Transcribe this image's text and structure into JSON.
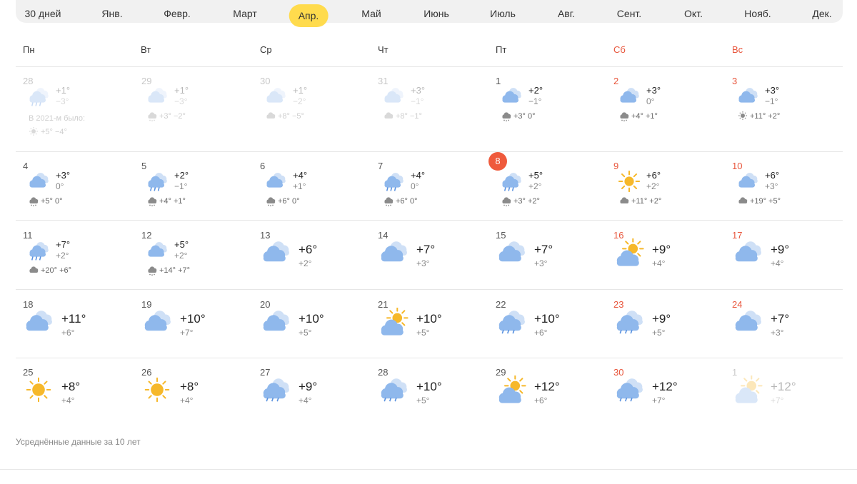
{
  "months": [
    "30 дней",
    "Янв.",
    "Февр.",
    "Март",
    "Апр.",
    "Май",
    "Июнь",
    "Июль",
    "Авг.",
    "Сент.",
    "Окт.",
    "Нояб.",
    "Дек."
  ],
  "active_month": 4,
  "weekdays": [
    "Пн",
    "Вт",
    "Ср",
    "Чт",
    "Пт",
    "Сб",
    "Вс"
  ],
  "footer_note": "Усреднённые данные за 10 лет",
  "history_2021_note": "В 2021-м было:",
  "weeks": [
    [
      {
        "d": "28",
        "faded": true,
        "icon": "cloud-rain",
        "hi": "+1°",
        "lo": "−3°",
        "h_icon": "sun",
        "h": "+5° −4°",
        "note": true
      },
      {
        "d": "29",
        "faded": true,
        "icon": "cloud",
        "hi": "+1°",
        "lo": "−3°",
        "h_icon": "sun-rain",
        "h": "+3° −2°"
      },
      {
        "d": "30",
        "faded": true,
        "icon": "cloud",
        "hi": "+1°",
        "lo": "−2°",
        "h_icon": "cloud-sun",
        "h": "+8° −5°"
      },
      {
        "d": "31",
        "faded": true,
        "icon": "cloud",
        "hi": "+3°",
        "lo": "−1°",
        "h_icon": "cloud-sun",
        "h": "+8° −1°"
      },
      {
        "d": "1",
        "icon": "cloud",
        "hi": "+2°",
        "lo": "−1°",
        "h_icon": "cloud-snow",
        "h": "+3° 0°"
      },
      {
        "d": "2",
        "icon": "cloud",
        "hi": "+3°",
        "lo": "0°",
        "h_icon": "cloud-snow",
        "h": "+4° +1°"
      },
      {
        "d": "3",
        "icon": "cloud",
        "hi": "+3°",
        "lo": "−1°",
        "h_icon": "sun",
        "h": "+11° +2°"
      }
    ],
    [
      {
        "d": "4",
        "icon": "cloud",
        "hi": "+3°",
        "lo": "0°",
        "h_icon": "cloud-snow",
        "h": "+5° 0°"
      },
      {
        "d": "5",
        "icon": "cloud-rain",
        "hi": "+2°",
        "lo": "−1°",
        "h_icon": "cloud-snow",
        "h": "+4° +1°"
      },
      {
        "d": "6",
        "icon": "cloud",
        "hi": "+4°",
        "lo": "+1°",
        "h_icon": "sun-snow",
        "h": "+6° 0°"
      },
      {
        "d": "7",
        "icon": "cloud-rain",
        "hi": "+4°",
        "lo": "0°",
        "h_icon": "cloud-snow",
        "h": "+6° 0°"
      },
      {
        "d": "8",
        "today": true,
        "icon": "cloud-rain",
        "hi": "+5°",
        "lo": "+2°",
        "h_icon": "cloud-snow",
        "h": "+3° +2°"
      },
      {
        "d": "9",
        "icon": "sun",
        "hi": "+6°",
        "lo": "+2°",
        "h_icon": "cloud-dark",
        "h": "+11° +2°"
      },
      {
        "d": "10",
        "icon": "cloud",
        "hi": "+6°",
        "lo": "+3°",
        "h_icon": "cloud-dark",
        "h": "+19° +5°"
      }
    ],
    [
      {
        "d": "11",
        "icon": "cloud-rain",
        "hi": "+7°",
        "lo": "+2°",
        "h_icon": "cloud-dark",
        "h": "+20° +6°"
      },
      {
        "d": "12",
        "icon": "cloud",
        "hi": "+5°",
        "lo": "+2°",
        "h_icon": "sun-rain-dark",
        "h": "+14° +7°"
      },
      {
        "d": "13",
        "icon": "cloud",
        "big": true,
        "hi": "+6°",
        "lo": "+2°"
      },
      {
        "d": "14",
        "icon": "cloud",
        "big": true,
        "hi": "+7°",
        "lo": "+3°"
      },
      {
        "d": "15",
        "icon": "cloud",
        "big": true,
        "hi": "+7°",
        "lo": "+3°"
      },
      {
        "d": "16",
        "icon": "sun-cloud",
        "big": true,
        "hi": "+9°",
        "lo": "+4°"
      },
      {
        "d": "17",
        "icon": "cloud",
        "big": true,
        "hi": "+9°",
        "lo": "+4°"
      }
    ],
    [
      {
        "d": "18",
        "icon": "cloud",
        "big": true,
        "hi": "+11°",
        "lo": "+6°"
      },
      {
        "d": "19",
        "icon": "cloud",
        "big": true,
        "hi": "+10°",
        "lo": "+7°"
      },
      {
        "d": "20",
        "icon": "cloud",
        "big": true,
        "hi": "+10°",
        "lo": "+5°"
      },
      {
        "d": "21",
        "icon": "sun-cloud",
        "big": true,
        "hi": "+10°",
        "lo": "+5°"
      },
      {
        "d": "22",
        "icon": "cloud-rain",
        "big": true,
        "hi": "+10°",
        "lo": "+6°"
      },
      {
        "d": "23",
        "icon": "cloud-rain",
        "big": true,
        "hi": "+9°",
        "lo": "+5°"
      },
      {
        "d": "24",
        "icon": "cloud",
        "big": true,
        "hi": "+7°",
        "lo": "+3°"
      }
    ],
    [
      {
        "d": "25",
        "icon": "sun",
        "big": true,
        "hi": "+8°",
        "lo": "+4°"
      },
      {
        "d": "26",
        "icon": "sun",
        "big": true,
        "hi": "+8°",
        "lo": "+4°"
      },
      {
        "d": "27",
        "icon": "cloud-rain",
        "big": true,
        "hi": "+9°",
        "lo": "+4°"
      },
      {
        "d": "28",
        "icon": "cloud-rain",
        "big": true,
        "hi": "+10°",
        "lo": "+5°"
      },
      {
        "d": "29",
        "icon": "sun-cloud",
        "big": true,
        "hi": "+12°",
        "lo": "+6°"
      },
      {
        "d": "30",
        "icon": "cloud-rain",
        "big": true,
        "hi": "+12°",
        "lo": "+7°"
      },
      {
        "d": "1",
        "faded": true,
        "icon": "sun-cloud",
        "big": true,
        "hi": "+12°",
        "lo": "+7°"
      }
    ]
  ]
}
